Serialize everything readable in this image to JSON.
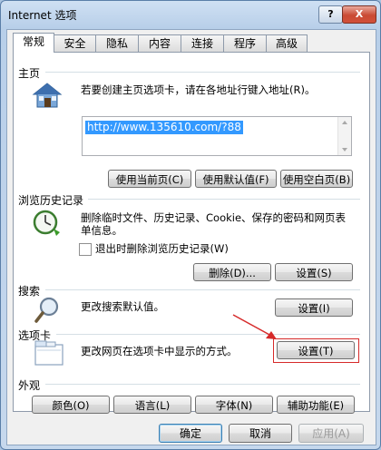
{
  "window": {
    "title": "Internet 选项"
  },
  "tabs": [
    {
      "label": "常规"
    },
    {
      "label": "安全"
    },
    {
      "label": "隐私"
    },
    {
      "label": "内容"
    },
    {
      "label": "连接"
    },
    {
      "label": "程序"
    },
    {
      "label": "高级"
    }
  ],
  "homepage": {
    "section": "主页",
    "desc": "若要创建主页选项卡，请在各地址行键入地址(R)。",
    "url": "http://www.135610.com/?88",
    "btn_current": "使用当前页(C)",
    "btn_default": "使用默认值(F)",
    "btn_blank": "使用空白页(B)"
  },
  "history": {
    "section": "浏览历史记录",
    "desc": "删除临时文件、历史记录、Cookie、保存的密码和网页表单信息。",
    "checkbox": "退出时删除浏览历史记录(W)",
    "btn_delete": "删除(D)...",
    "btn_settings": "设置(S)"
  },
  "search": {
    "section": "搜索",
    "desc": "更改搜索默认值。",
    "btn_settings": "设置(I)"
  },
  "tabsection": {
    "section": "选项卡",
    "desc": "更改网页在选项卡中显示的方式。",
    "btn_settings": "设置(T)"
  },
  "appearance": {
    "section": "外观",
    "btn_colors": "颜色(O)",
    "btn_languages": "语言(L)",
    "btn_fonts": "字体(N)",
    "btn_accessibility": "辅助功能(E)"
  },
  "footer": {
    "ok": "确定",
    "cancel": "取消",
    "apply": "应用(A)"
  },
  "titlebar": {
    "help": "?",
    "close": "X"
  },
  "colors": {
    "highlight": "#d62a2a",
    "accent": "#3399ff"
  }
}
